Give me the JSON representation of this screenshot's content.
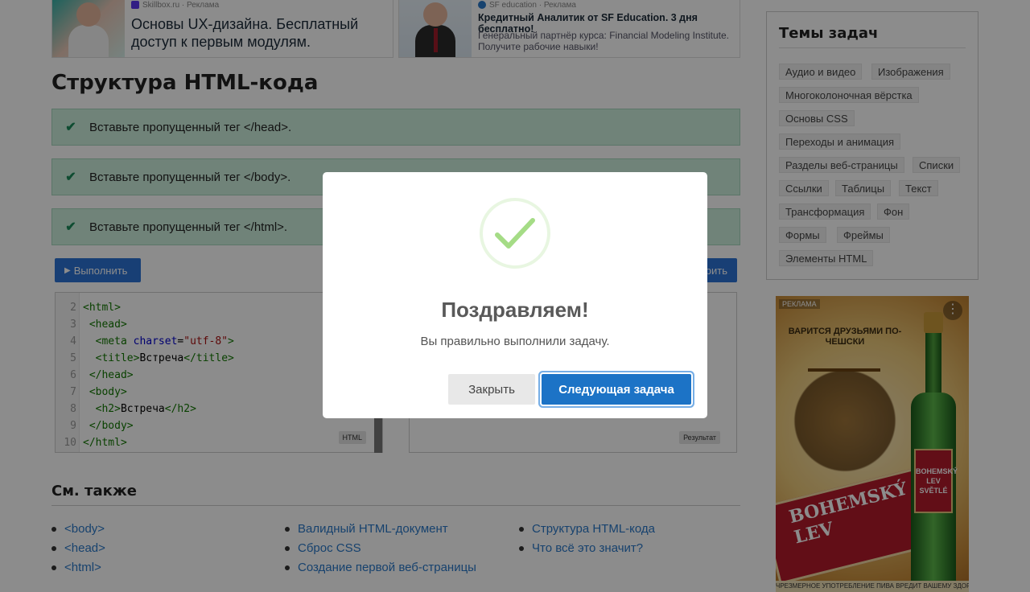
{
  "ads": {
    "ad1": {
      "advertiser": "Skillbox.ru · Реклама",
      "title": "Основы UX-дизайна. Бесплатный доступ к первым модулям."
    },
    "ad2": {
      "advertiser": "SF education · Реклама",
      "title": "Кредитный Аналитик от SF Education. 3 дня бесплатно!",
      "subtitle": "Генеральный партнёр курса: Financial Modeling Institute. Получите рабочие навыки!"
    }
  },
  "page": {
    "title": "Структура HTML-кода"
  },
  "tasks": [
    {
      "text": "Вставьте пропущенный тег </head>."
    },
    {
      "text": "Вставьте пропущенный тег </body>."
    },
    {
      "text": "Вставьте пропущенный тег </html>."
    }
  ],
  "toolbar": {
    "run_label": "Выполнить",
    "run_right_label": "рить"
  },
  "editor": {
    "badge": "HTML",
    "lines": [
      {
        "num": "2",
        "parts": [
          [
            "tag",
            "<html>"
          ]
        ]
      },
      {
        "num": "3",
        "parts": [
          [
            "txt",
            " "
          ],
          [
            "tag",
            "<head>"
          ]
        ]
      },
      {
        "num": "4",
        "parts": [
          [
            "txt",
            "  "
          ],
          [
            "tag",
            "<meta "
          ],
          [
            "attr",
            "charset"
          ],
          [
            "txt",
            "="
          ],
          [
            "str",
            "\"utf-8\""
          ],
          [
            "tag",
            ">"
          ]
        ]
      },
      {
        "num": "5",
        "parts": [
          [
            "txt",
            "  "
          ],
          [
            "tag",
            "<title>"
          ],
          [
            "txt",
            "Встреча"
          ],
          [
            "tag",
            "</title>"
          ]
        ]
      },
      {
        "num": "6",
        "parts": [
          [
            "txt",
            " "
          ],
          [
            "tag",
            "</head>"
          ]
        ]
      },
      {
        "num": "7",
        "parts": [
          [
            "txt",
            " "
          ],
          [
            "tag",
            "<body>"
          ]
        ]
      },
      {
        "num": "8",
        "parts": [
          [
            "txt",
            "  "
          ],
          [
            "tag",
            "<h2>"
          ],
          [
            "txt",
            "Встреча"
          ],
          [
            "tag",
            "</h2>"
          ]
        ]
      },
      {
        "num": "9",
        "parts": [
          [
            "txt",
            " "
          ],
          [
            "tag",
            "</body>"
          ]
        ]
      },
      {
        "num": "10",
        "parts": [
          [
            "tag",
            "</html>"
          ]
        ]
      }
    ]
  },
  "result": {
    "badge": "Результат"
  },
  "see_also": {
    "title": "См. также",
    "col1": [
      "<body>",
      "<head>",
      "<html>"
    ],
    "col2": [
      "Валидный HTML-документ",
      "Сброс CSS",
      "Создание первой веб-страницы"
    ],
    "col3": [
      "Структура HTML-кода",
      "Что всё это значит?"
    ]
  },
  "topics": {
    "title": "Темы задач",
    "items": [
      "Аудио и видео",
      "Изображения",
      "Многоколоночная вёрстка",
      "Основы CSS",
      "Переходы и анимация",
      "Разделы веб-страницы",
      "Списки",
      "Ссылки",
      "Таблицы",
      "Текст",
      "Трансформация",
      "Фон",
      "Формы",
      "Фреймы",
      "Элементы HTML"
    ]
  },
  "beer_ad": {
    "label": "РЕКЛАМА",
    "slogan": "ВАРИТСЯ ДРУЗЬЯМИ ПО-ЧЕШСКИ",
    "brand_line1": "BOHEMSKÝ",
    "brand_line2": "LEV",
    "bottle_label": "BOHEMSKÝ LEV SVĚTLÉ",
    "footer": "ЧРЕЗМЕРНОЕ УПОТРЕБЛЕНИЕ ПИВА ВРЕДИТ ВАШЕМУ ЗДОРОВЬЮ"
  },
  "modal": {
    "title": "Поздравляем!",
    "text": "Вы правильно выполнили задачу.",
    "close_label": "Закрыть",
    "next_label": "Следующая задача"
  },
  "colors": {
    "accent": "#1c73c6",
    "success": "#a5dc86",
    "task_bg": "#cdeedd"
  }
}
